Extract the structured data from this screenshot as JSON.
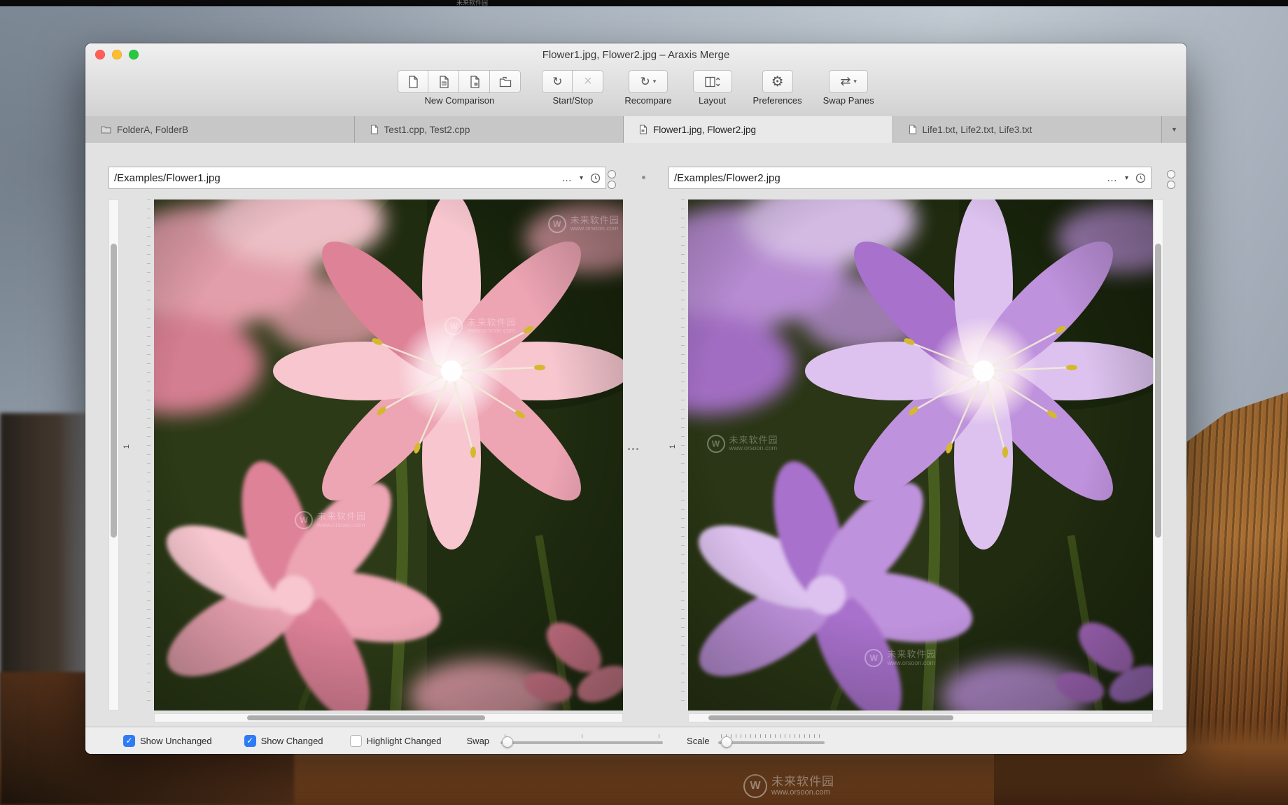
{
  "window": {
    "title": "Flower1.jpg, Flower2.jpg – Araxis Merge"
  },
  "toolbar": {
    "new_comparison": "New Comparison",
    "start_stop": "Start/Stop",
    "recompare": "Recompare",
    "layout": "Layout",
    "preferences": "Preferences",
    "swap_panes": "Swap Panes"
  },
  "tabs": [
    {
      "label": "FolderA, FolderB"
    },
    {
      "label": "Test1.cpp, Test2.cpp"
    },
    {
      "label": "Flower1.jpg, Flower2.jpg"
    },
    {
      "label": "Life1.txt, Life2.txt, Life3.txt"
    }
  ],
  "left_pane": {
    "path": "/Examples/Flower1.jpg",
    "line_marker": "1"
  },
  "right_pane": {
    "path": "/Examples/Flower2.jpg",
    "line_marker": "1"
  },
  "bottom_bar": {
    "show_unchanged": "Show Unchanged",
    "show_changed": "Show Changed",
    "highlight_changed": "Highlight Changed",
    "swap_label": "Swap",
    "scale_label": "Scale"
  },
  "glyphs": {
    "ellipsis": "…",
    "dropdown": "▾",
    "overflow": "▼",
    "check": "✓",
    "gear": "⚙",
    "reload": "↻",
    "stop": "×",
    "swap": "⇄"
  },
  "watermark": {
    "logo": "W",
    "name": "未来软件园",
    "site": "www.orsoon.com"
  },
  "colors": {
    "checkbox_accent": "#2e7bf6",
    "left_flower": "#eda4b3",
    "right_flower": "#bf92dd",
    "stamen": "#d4b92e"
  }
}
